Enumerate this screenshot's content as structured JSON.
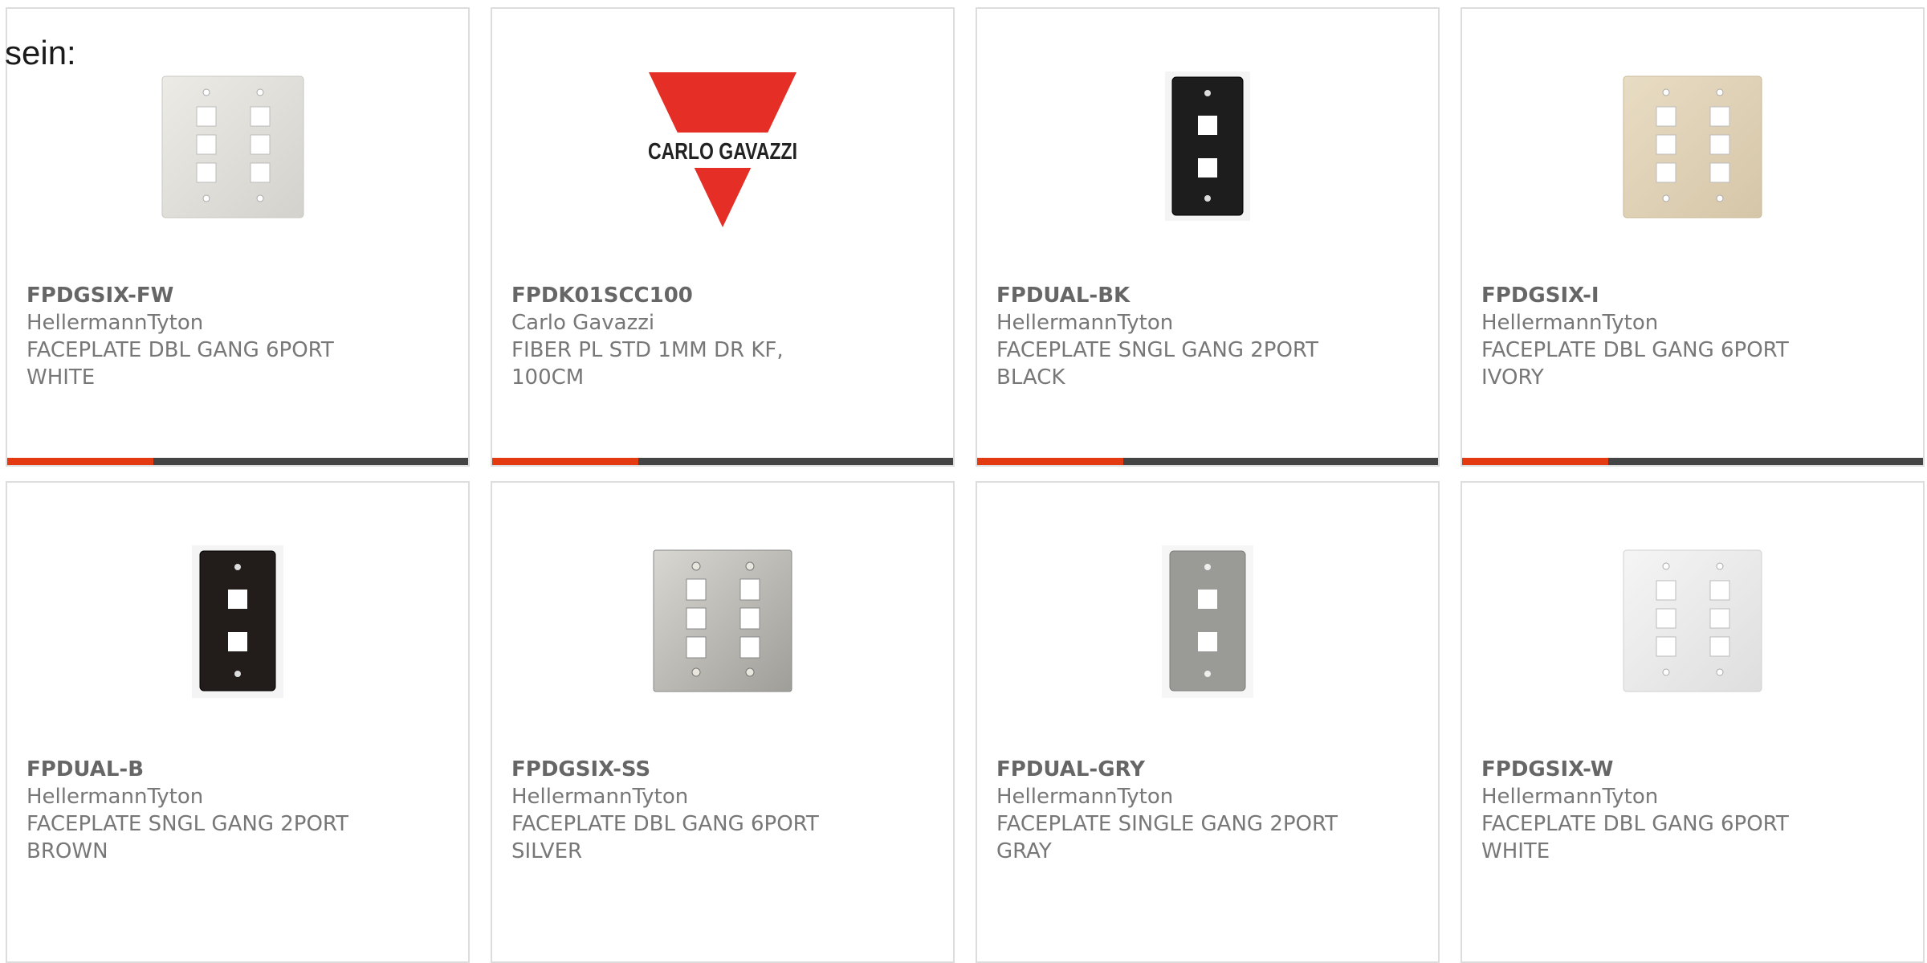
{
  "page": {
    "lead_text": "sein:"
  },
  "colors": {
    "accent": "#e43a12",
    "bar": "#444444",
    "text": "#777777",
    "part_text": "#666666"
  },
  "products": [
    {
      "part": "FPDGSIX-FW",
      "maker": "HellermannTyton",
      "desc": "FACEPLATE DBL GANG 6PORT WHITE",
      "image": "faceplate-double-6port-white-icon"
    },
    {
      "part": "FPDK01SCC100",
      "maker": "Carlo Gavazzi",
      "desc": "FIBER PL STD 1MM DR KF, 100CM",
      "image": "carlo-gavazzi-logo",
      "logo_text": "CARLO GAVAZZI"
    },
    {
      "part": "FPDUAL-BK",
      "maker": "HellermannTyton",
      "desc": "FACEPLATE SNGL GANG 2PORT BLACK",
      "image": "faceplate-single-2port-black-icon"
    },
    {
      "part": "FPDGSIX-I",
      "maker": "HellermannTyton",
      "desc": "FACEPLATE DBL GANG 6PORT IVORY",
      "image": "faceplate-double-6port-ivory-icon"
    },
    {
      "part": "FPDUAL-B",
      "maker": "HellermannTyton",
      "desc": "FACEPLATE SNGL GANG 2PORT BROWN",
      "image": "faceplate-single-2port-brown-icon"
    },
    {
      "part": "FPDGSIX-SS",
      "maker": "HellermannTyton",
      "desc": "FACEPLATE DBL GANG 6PORT SILVER",
      "image": "faceplate-double-6port-silver-icon"
    },
    {
      "part": "FPDUAL-GRY",
      "maker": "HellermannTyton",
      "desc": "FACEPLATE SINGLE GANG 2PORT GRAY",
      "image": "faceplate-single-2port-gray-icon"
    },
    {
      "part": "FPDGSIX-W",
      "maker": "HellermannTyton",
      "desc": "FACEPLATE DBL GANG 6PORT WHITE",
      "image": "faceplate-double-6port-white-icon"
    }
  ]
}
